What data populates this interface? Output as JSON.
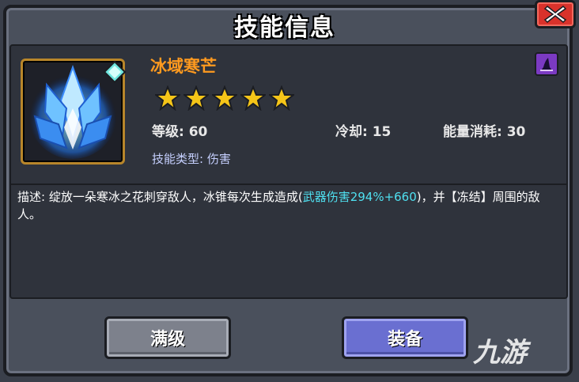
{
  "header": {
    "title": "技能信息"
  },
  "skill": {
    "name": "冰域寒芒",
    "stars": 5,
    "level_label": "等级: ",
    "level_value": "60",
    "cooldown_label": "冷却: ",
    "cooldown_value": "15",
    "energy_label": "能量消耗: ",
    "energy_value": "30",
    "type_label": "技能类型: ",
    "type_value": "伤害",
    "desc_prefix": "描述: 绽放一朵寒冰之花刺穿敌人，冰锥每次生成造成(",
    "desc_highlight": "武器伤害294%+660",
    "desc_suffix": ")，并【冻结】周围的敌人。"
  },
  "buttons": {
    "max_label": "满级",
    "equip_label": "装备"
  },
  "watermark": {
    "text": "九游"
  },
  "icons": {
    "close": "close-icon",
    "skill": "ice-crystal-icon",
    "gem": "diamond-gem-icon",
    "badge": "wizard-hat-icon",
    "star": "star-icon"
  },
  "colors": {
    "name": "#ff9a1f",
    "highlight": "#4fe0f0",
    "star": "#f5c518",
    "close": "#d9322b",
    "equip": "#6a6fd1",
    "max": "#7d818c"
  }
}
